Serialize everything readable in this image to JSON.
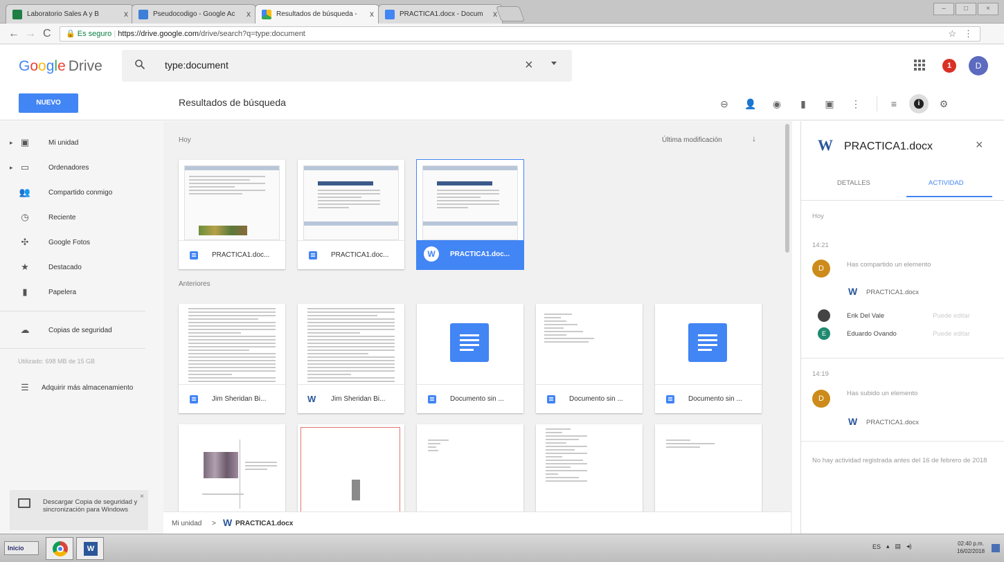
{
  "browser": {
    "tabs": [
      {
        "title": "Laboratorio Sales A y B",
        "close": "x"
      },
      {
        "title": "Pseudocodigo - Google Ac",
        "close": "x"
      },
      {
        "title": "Resultados de búsqueda -",
        "close": "x"
      },
      {
        "title": "PRACTICA1.docx - Docum",
        "close": "x"
      }
    ],
    "secure_label": "Es seguro",
    "url_host": "https://drive.google.com",
    "url_path": "/drive/search?q=type:document"
  },
  "header": {
    "logo_g1": "G",
    "logo_g2": "o",
    "logo_g3": "o",
    "logo_g4": "g",
    "logo_g5": "l",
    "logo_g6": "e",
    "logo_product": "Drive",
    "search_value": "type:document",
    "notification_count": "1",
    "avatar_letter": "D"
  },
  "toolbar": {
    "new_label": "NUEVO",
    "page_title": "Resultados de búsqueda"
  },
  "sidebar": {
    "items": [
      {
        "label": "Mi unidad"
      },
      {
        "label": "Ordenadores"
      },
      {
        "label": "Compartido conmigo"
      },
      {
        "label": "Reciente"
      },
      {
        "label": "Google Fotos"
      },
      {
        "label": "Destacado"
      },
      {
        "label": "Papelera"
      },
      {
        "label": "Copias de seguridad"
      }
    ],
    "storage": "Utilizado: 698 MB de 15 GB",
    "buy_storage": "Adquirir más almacenamiento",
    "promo": "Descargar Copia de seguridad y sincronización para Windows",
    "promo_close": "×"
  },
  "main": {
    "section_today": "Hoy",
    "section_earlier": "Anteriores",
    "sort_label": "Última modificación",
    "today_files": [
      {
        "name": "PRACTICA1.doc...",
        "type": "gdoc"
      },
      {
        "name": "PRACTICA1.doc...",
        "type": "gdoc"
      },
      {
        "name": "PRACTICA1.doc...",
        "type": "word"
      }
    ],
    "earlier_files": [
      {
        "name": "Jim Sheridan Bi...",
        "type": "gdoc"
      },
      {
        "name": "Jim Sheridan Bi...",
        "type": "word"
      },
      {
        "name": "Documento sin ...",
        "type": "gdoc"
      },
      {
        "name": "Documento sin ...",
        "type": "gdoc"
      },
      {
        "name": "Documento sin ...",
        "type": "gdoc"
      }
    ],
    "breadcrumb_root": "Mi unidad",
    "breadcrumb_sep": ">",
    "breadcrumb_file": "PRACTICA1.docx"
  },
  "panel": {
    "file_letter": "W",
    "title": "PRACTICA1.docx",
    "tab_details": "DETALLES",
    "tab_activity": "ACTIVIDAD",
    "day": "Hoy",
    "events": [
      {
        "time": "14:21",
        "avatar": "D",
        "text": "Has compartido un elemento",
        "file": "PRACTICA1.docx"
      },
      {
        "time": "14:19",
        "avatar": "D",
        "text": "Has subido un elemento",
        "file": "PRACTICA1.docx"
      }
    ],
    "people": [
      {
        "name": "Erik Del Vale",
        "perm": "Puede editar"
      },
      {
        "name": "Eduardo Ovando",
        "perm": "Puede editar",
        "initial": "E"
      }
    ],
    "no_activity": "No hay actividad registrada antes del 16 de febrero de 2018"
  },
  "taskbar": {
    "start_label": "Inicio",
    "lang": "ES",
    "time": "02:40 p.m.",
    "date": "16/02/2018"
  },
  "colors": {
    "accent": "#4285f4",
    "word_blue": "#2b579a",
    "avatar_orange": "#cc8b1a",
    "notif_red": "#d93025"
  }
}
